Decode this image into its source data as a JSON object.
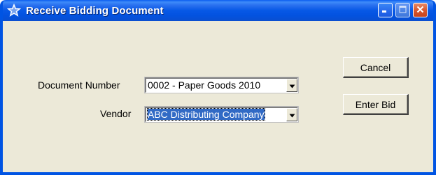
{
  "window": {
    "title": "Receive Bidding Document",
    "title_icon": "star-icon"
  },
  "titlebar_buttons": {
    "minimize_icon": "minimize-icon",
    "maximize_icon": "maximize-icon",
    "close_icon": "close-icon"
  },
  "form": {
    "document_number_label": "Document Number",
    "document_number_value": "0002 - Paper Goods 2010",
    "vendor_label": "Vendor",
    "vendor_value": "ABC Distributing Company"
  },
  "buttons": {
    "cancel_label": "Cancel",
    "enter_bid_label": "Enter Bid"
  },
  "colors": {
    "titlebar": "#0054e3",
    "window_background": "#ece9d8",
    "selection": "#316ac5",
    "close_button": "#d8582f"
  }
}
